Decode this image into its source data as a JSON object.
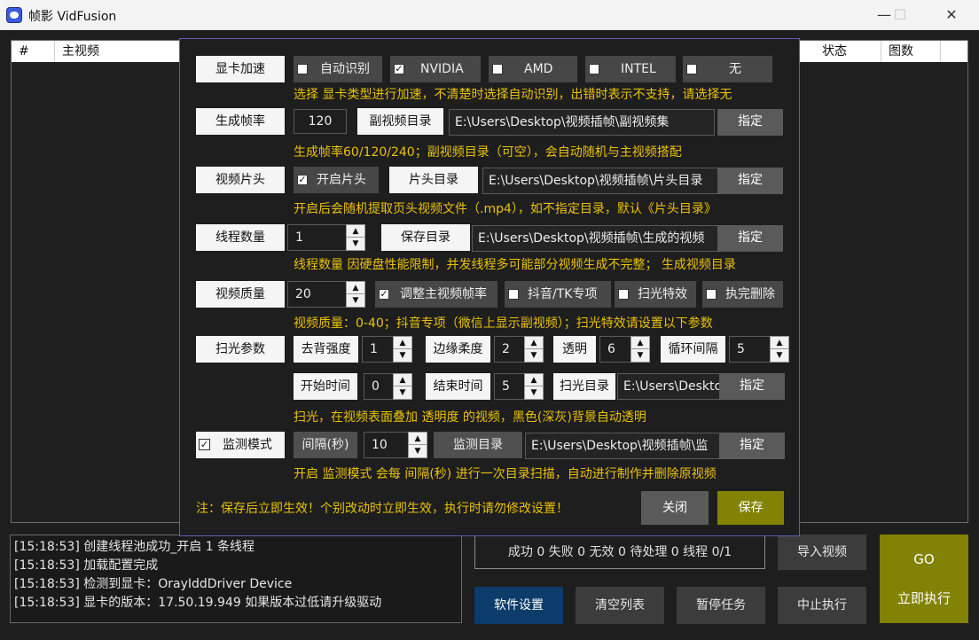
{
  "window": {
    "title": "帧影 VidFusion",
    "minimize": "—",
    "maximize": "☐",
    "close": "✕"
  },
  "table": {
    "headers": [
      "#",
      "主视频",
      "状态",
      "图数"
    ]
  },
  "log": [
    "[15:18:53] 创建线程池成功_开启 1 条线程",
    "[15:18:53] 加载配置完成",
    "[15:18:53] 检测到显卡：OrayIddDriver Device",
    "[15:18:53] 显卡的版本：17.50.19.949 如果版本过低请升级驱动"
  ],
  "stats": "成功 0 失败 0 无效 0 待处理 0 线程 0/1",
  "bottom_buttons": {
    "import": "导入视频",
    "settings": "软件设置",
    "clear": "清空列表",
    "pause": "暂停任务",
    "stop": "中止执行",
    "go_line1": "GO",
    "go_line2": "立即执行"
  },
  "settings": {
    "gpu": {
      "label": "显卡加速",
      "options": [
        {
          "label": "自动识别",
          "checked": false,
          "mark": ""
        },
        {
          "label": "NVIDIA",
          "checked": true,
          "mark": "✓"
        },
        {
          "label": "AMD",
          "checked": false,
          "mark": ""
        },
        {
          "label": "INTEL",
          "checked": false,
          "mark": ""
        },
        {
          "label": "无",
          "checked": false,
          "mark": ""
        }
      ],
      "hint": "选择 显卡类型进行加速，不清楚时选择自动识别，出错时表示不支持，请选择无"
    },
    "fps": {
      "label": "生成帧率",
      "value": "120",
      "subdir_label": "副视频目录",
      "subdir_path": "E:\\Users\\Desktop\\视频插帧\\副视频集",
      "assign": "指定",
      "hint": "生成帧率60/120/240；副视频目录（可空），会自动随机与主视频搭配"
    },
    "intro": {
      "label": "视频片头",
      "enable_label": "开启片头",
      "enable_mark": "✓",
      "dir_label": "片头目录",
      "dir_path": "E:\\Users\\Desktop\\视频插帧\\片头目录",
      "assign": "指定",
      "hint": "开启后会随机提取页头视频文件（.mp4），如不指定目录，默认《片头目录》"
    },
    "threads": {
      "label": "线程数量",
      "value": "1",
      "save_label": "保存目录",
      "save_path": "E:\\Users\\Desktop\\视频插帧\\生成的视频",
      "assign": "指定",
      "hint": "线程数量 因硬盘性能限制，并发线程多可能部分视频生成不完整；  生成视频目录"
    },
    "quality": {
      "label": "视频质量",
      "value": "20",
      "opt1_label": "调整主视频帧率",
      "opt1_mark": "✓",
      "opt2_label": "抖音/TK专项",
      "opt3_label": "扫光特效",
      "opt4_label": "执完删除",
      "hint": "视频质量：0-40；抖音专项（微信上显示副视频）；扫光特效请设置以下参数"
    },
    "sweep": {
      "label": "扫光参数",
      "strength_label": "去背强度",
      "strength_value": "1",
      "soft_label": "边缘柔度",
      "soft_value": "2",
      "opacity_label": "透明",
      "opacity_value": "6",
      "loop_label": "循环间隔",
      "loop_value": "5",
      "start_label": "开始时间",
      "start_value": "0",
      "end_label": "结束时间",
      "end_value": "5",
      "dir_label": "扫光目录",
      "dir_path": "E:\\Users\\Desktop",
      "assign": "指定",
      "hint": "扫光，在视频表面叠加 透明度 的视频，黑色(深灰)背景自动透明"
    },
    "monitor": {
      "label": "监测模式",
      "mark": "✓",
      "interval_label": "间隔(秒)",
      "interval_value": "10",
      "dir_label": "监测目录",
      "dir_path": "E:\\Users\\Desktop\\视频插帧\\监",
      "assign": "指定",
      "hint": "开启 监测模式 会每 间隔(秒) 进行一次目录扫描，自动进行制作并删除原视频"
    },
    "footer_note": "注：保存后立即生效！个别改动时立即生效，执行时请勿修改设置！",
    "close": "关闭",
    "save": "保存"
  }
}
